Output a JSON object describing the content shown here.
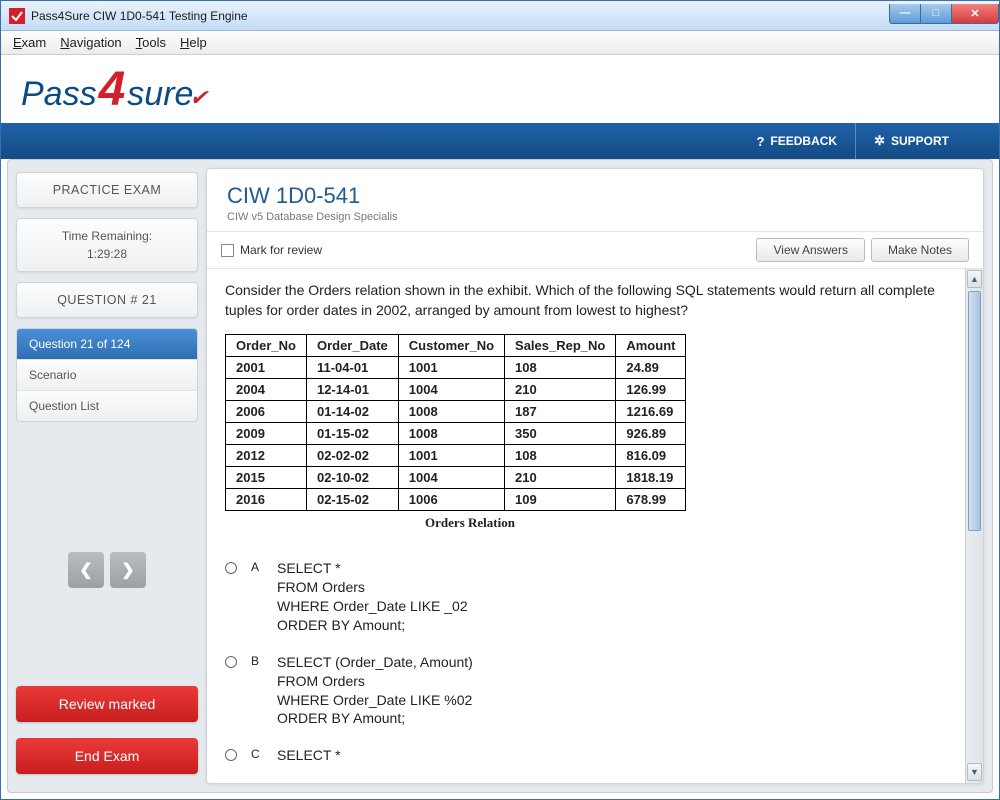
{
  "window": {
    "title": "Pass4Sure CIW 1D0-541 Testing Engine"
  },
  "menubar": {
    "items": [
      "Exam",
      "Navigation",
      "Tools",
      "Help"
    ]
  },
  "logo": {
    "left": "Pass",
    "mid": "4",
    "right": "sure"
  },
  "topbar": {
    "feedback": "FEEDBACK",
    "support": "SUPPORT"
  },
  "sidebar": {
    "practice": "PRACTICE EXAM",
    "time_label": "Time Remaining:",
    "time_value": "1:29:28",
    "question_header": "QUESTION # 21",
    "tabs": {
      "current": "Question 21 of 124",
      "scenario": "Scenario",
      "list": "Question List"
    },
    "review": "Review marked",
    "end": "End Exam"
  },
  "main": {
    "title": "CIW 1D0-541",
    "subtitle": "CIW v5 Database Design Specialis",
    "mark": "Mark for review",
    "view": "View Answers",
    "notes": "Make Notes"
  },
  "question": {
    "text": "Consider the Orders relation shown in the exhibit. Which of the following SQL statements would return all complete tuples for order dates in 2002, arranged by amount from lowest to highest?",
    "caption": "Orders Relation",
    "headers": [
      "Order_No",
      "Order_Date",
      "Customer_No",
      "Sales_Rep_No",
      "Amount"
    ],
    "rows": [
      [
        "2001",
        "11-04-01",
        "1001",
        "108",
        "24.89"
      ],
      [
        "2004",
        "12-14-01",
        "1004",
        "210",
        "126.99"
      ],
      [
        "2006",
        "01-14-02",
        "1008",
        "187",
        "1216.69"
      ],
      [
        "2009",
        "01-15-02",
        "1008",
        "350",
        "926.89"
      ],
      [
        "2012",
        "02-02-02",
        "1001",
        "108",
        "816.09"
      ],
      [
        "2015",
        "02-10-02",
        "1004",
        "210",
        "1818.19"
      ],
      [
        "2016",
        "02-15-02",
        "1006",
        "109",
        "678.99"
      ]
    ],
    "choices": [
      {
        "letter": "A",
        "text": "SELECT *\nFROM Orders\nWHERE Order_Date LIKE _02\nORDER BY Amount;"
      },
      {
        "letter": "B",
        "text": "SELECT (Order_Date, Amount)\nFROM Orders\nWHERE Order_Date LIKE %02\nORDER BY Amount;"
      },
      {
        "letter": "C",
        "text": "SELECT *"
      }
    ]
  }
}
